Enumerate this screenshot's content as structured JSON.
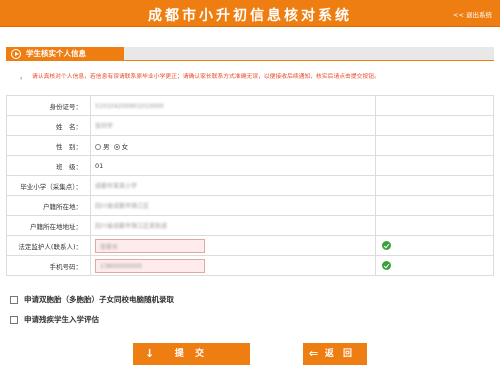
{
  "header": {
    "title": "成都市小升初信息核对系统",
    "back_link": "<< 退出系统"
  },
  "section": {
    "title": "学生核实个人信息"
  },
  "notice": {
    "text": "请认真核对个人信息，若信息有误请联系原毕业小学更正；请确认家长联系方式准确无误，以便接收后续通知，核实后请点击提交按钮。"
  },
  "form": {
    "rows": [
      {
        "label": "身份证号：",
        "value": "510104200901010000"
      },
      {
        "label": "姓　名：",
        "value": "张同学"
      },
      {
        "label": "性　别：",
        "male": "男",
        "female": "女"
      },
      {
        "label": "班　级：",
        "value": "01"
      },
      {
        "label": "毕业小学（采集点）：",
        "value": "成都市某某小学"
      },
      {
        "label": "户籍所在地：",
        "value": "四川省成都市锦江区"
      },
      {
        "label": "户籍所在地地址：",
        "value": "四川省成都市锦江区某街道"
      },
      {
        "label": "法定监护人(联系人)：",
        "value": "张家长"
      },
      {
        "label": "手机号码：",
        "value": "13800000000"
      }
    ]
  },
  "options": {
    "twins": "申请双胞胎（多胞胎）子女同校电脑随机录取",
    "disability": "申请残疾学生入学评估"
  },
  "buttons": {
    "submit": "提 交",
    "submit_icon": "↓",
    "back": "返 回",
    "back_icon": "⇐"
  },
  "colors": {
    "accent": "#ef7e12",
    "notice": "#e84a2b",
    "ok": "#3aa13a"
  }
}
